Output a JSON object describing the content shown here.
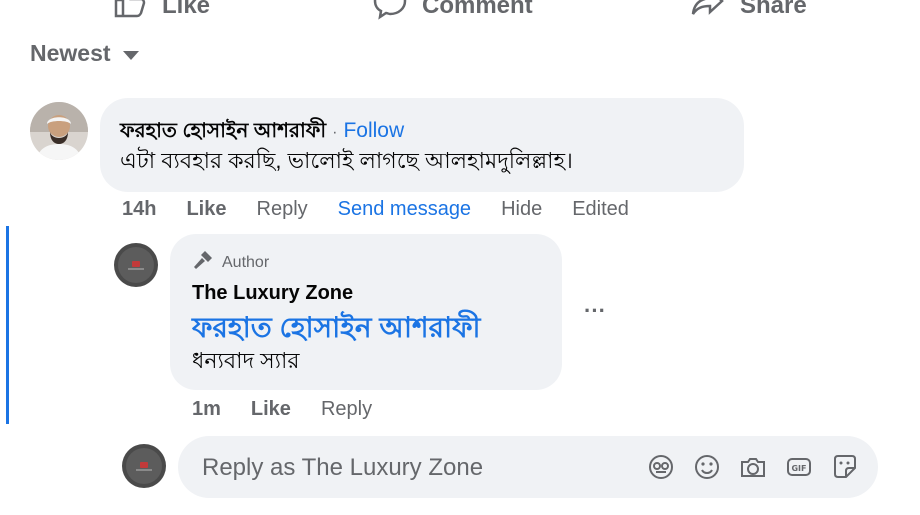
{
  "actions": {
    "like": "Like",
    "comment": "Comment",
    "share": "Share"
  },
  "sort": {
    "label": "Newest"
  },
  "comment": {
    "author": "ফরহাত হোসাইন আশরাফী",
    "separator": "·",
    "follow": "Follow",
    "text": "এটা ব্যবহার করছি, ভালোই লাগছে আলহামদুলিল্লাহ।",
    "meta": {
      "time": "14h",
      "like": "Like",
      "reply": "Reply",
      "send_message": "Send message",
      "hide": "Hide",
      "edited": "Edited"
    }
  },
  "reply": {
    "badge": "Author",
    "author": "The Luxury Zone",
    "mention": "ফরহাত হোসাইন আশরাফী",
    "text": "ধন্যবাদ স্যার",
    "more": "···",
    "meta": {
      "time": "1m",
      "like": "Like",
      "reply": "Reply"
    }
  },
  "composer": {
    "placeholder": "Reply as The Luxury Zone"
  },
  "colors": {
    "accent": "#1b74e4",
    "bubble": "#f0f2f5",
    "muted": "#65676b"
  }
}
